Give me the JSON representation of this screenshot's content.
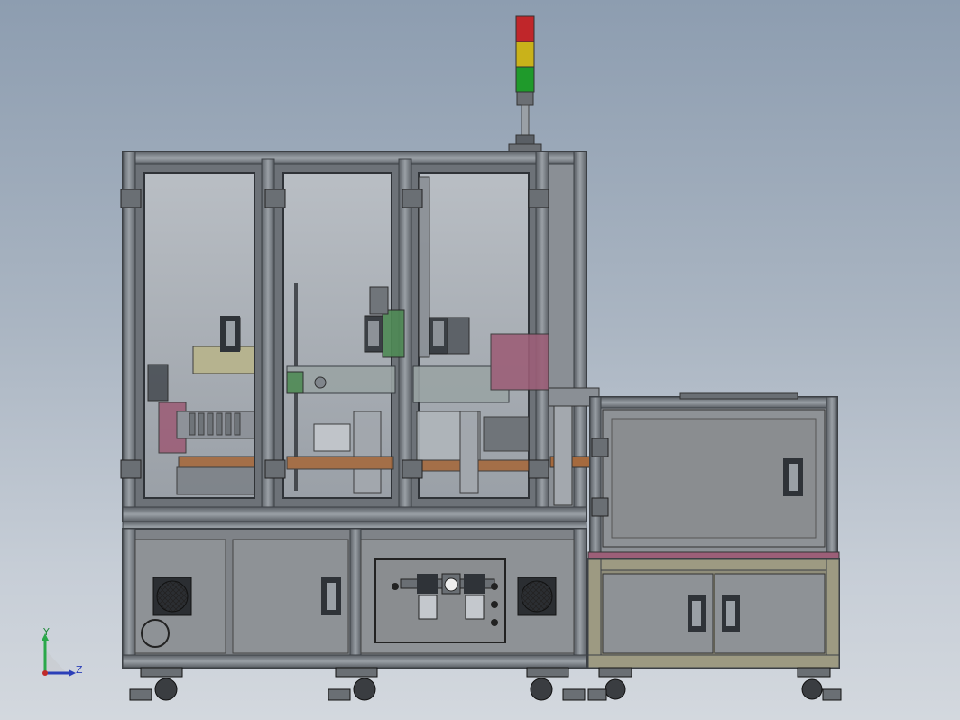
{
  "viewport": {
    "background_top": "#8d9db0",
    "background_bottom": "#d3d8de"
  },
  "colors": {
    "frame": "#7d8389",
    "frame_dark": "#4a4f55",
    "panel": "#8a8d90",
    "glass": "#a9afb6",
    "warning_red": "#c0262a",
    "warning_yellow": "#c9b21a",
    "warning_green": "#1f9a2b",
    "accent_magenta": "#9c5f78",
    "accent_green": "#4f8a55"
  },
  "triad": {
    "y_label": "Y",
    "z_label": "Z",
    "y_color": "#2aa84a",
    "z_color": "#2b3fb8",
    "x_color": "#c02a2a"
  },
  "icons": [
    "tower-light-icon",
    "fan-grille-icon",
    "caster-wheel-icon",
    "door-handle-icon",
    "pressure-gauge-icon"
  ]
}
